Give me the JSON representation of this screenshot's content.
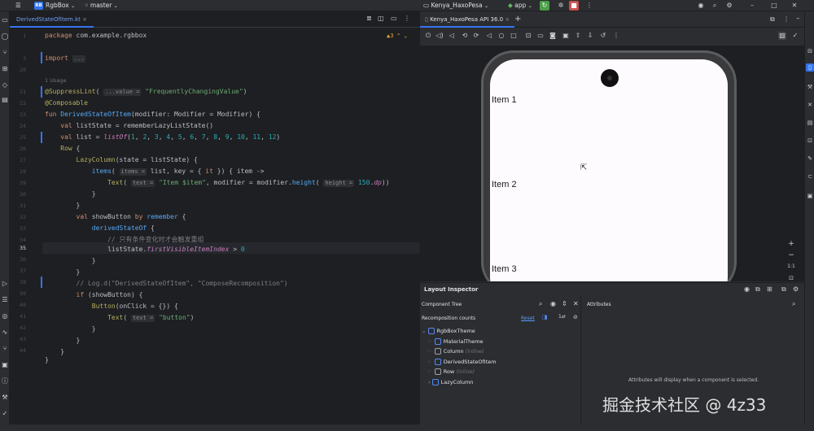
{
  "titlebar": {
    "project_badge": "RB",
    "project_name": "RgbBox",
    "branch": "master",
    "device": "Kenya_HaxoPesa",
    "run_config": "app"
  },
  "editor": {
    "tab_name": "DerivedStateOfItem.kt",
    "warnings": "3",
    "usage_hint": "1 Usage",
    "line_numbers": [
      "1",
      "3",
      "20",
      "21",
      "22",
      "23",
      "24",
      "25",
      "26",
      "27",
      "28",
      "29",
      "30",
      "31",
      "32",
      "33",
      "34",
      "35",
      "36",
      "37",
      "38",
      "39",
      "40",
      "41",
      "42",
      "43",
      "44"
    ]
  },
  "emulator": {
    "tab_name": "Kenya_HaxoPesa API 36.0",
    "items": [
      "Item 1",
      "Item 2",
      "Item 3"
    ],
    "zoom_label": "1:1"
  },
  "layout_inspector": {
    "title": "Layout Inspector",
    "component_tree": "Component Tree",
    "attributes": "Attributes",
    "recomposition_counts": "Recomposition counts",
    "reset": "Reset",
    "empty_message": "Attributes will display when a component is selected.",
    "tree": [
      {
        "label": "RgbBoxTheme",
        "tag": ""
      },
      {
        "label": "MaterialTheme",
        "tag": ""
      },
      {
        "label": "Column",
        "tag": "(inline)"
      },
      {
        "label": "DerivedStateOfItem",
        "tag": ""
      },
      {
        "label": "Row",
        "tag": "(inline)"
      },
      {
        "label": "LazyColumn",
        "tag": ""
      }
    ]
  },
  "watermark": "掘金技术社区 @ 4z33"
}
